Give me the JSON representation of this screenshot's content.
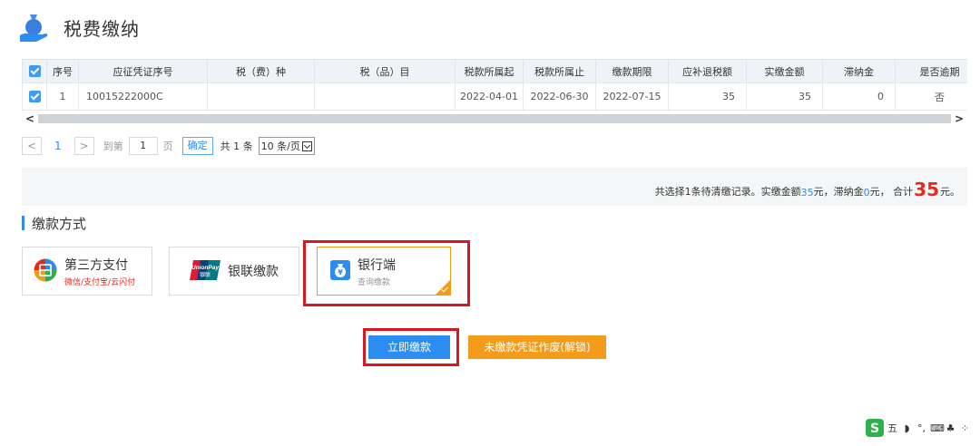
{
  "page": {
    "title": "税费缴纳"
  },
  "table": {
    "headers": [
      "序号",
      "应征凭证序号",
      "税（费）种",
      "税（品）目",
      "税款所属起",
      "税款所属止",
      "缴款期限",
      "应补退税额",
      "实缴金额",
      "滞纳金",
      "是否逾期"
    ],
    "rows": [
      {
        "index": "1",
        "voucher_no": "10015222000C",
        "tax_type": "",
        "tax_item": "",
        "period_start": "2022-04-01",
        "period_end": "2022-06-30",
        "deadline": "2022-07-15",
        "payable": "35",
        "paid": "35",
        "late_fee": "0",
        "overdue": "否"
      }
    ]
  },
  "scrollbar": {
    "left_arrow": "<",
    "right_arrow": ">"
  },
  "pager": {
    "prev": "<",
    "current": "1",
    "next": ">",
    "goto_label": "到第",
    "goto_value": "1",
    "page_unit": "页",
    "confirm": "确定",
    "total": "共 1 条",
    "page_size": "10 条/页"
  },
  "summary": {
    "prefix": "共选择1条待清缴记录。实缴金额",
    "paid_amount": "35",
    "mid1": " 元，滞纳金 ",
    "late_fee": "0",
    "mid2": "元， 合计",
    "total": "35",
    "suffix": "元。"
  },
  "payment": {
    "section_title": "缴款方式",
    "third_party": {
      "label": "第三方支付",
      "sub": "微信/支付宝/云闪付"
    },
    "unionpay": {
      "label": "银联缴款",
      "logo_top": "UnionPay",
      "logo_bottom": "银联"
    },
    "bank": {
      "label": "银行端",
      "sub": "查询缴款"
    }
  },
  "buttons": {
    "pay_now": "立即缴款",
    "void_voucher": "未缴款凭证作废(解锁)"
  },
  "ime": {
    "logo": "S",
    "items": [
      "五",
      "◗",
      "°,",
      "⌨",
      "♣",
      "⁘"
    ]
  },
  "colors": {
    "primary": "#2d8cf0",
    "orange": "#f39c19",
    "red": "#d7191f"
  }
}
